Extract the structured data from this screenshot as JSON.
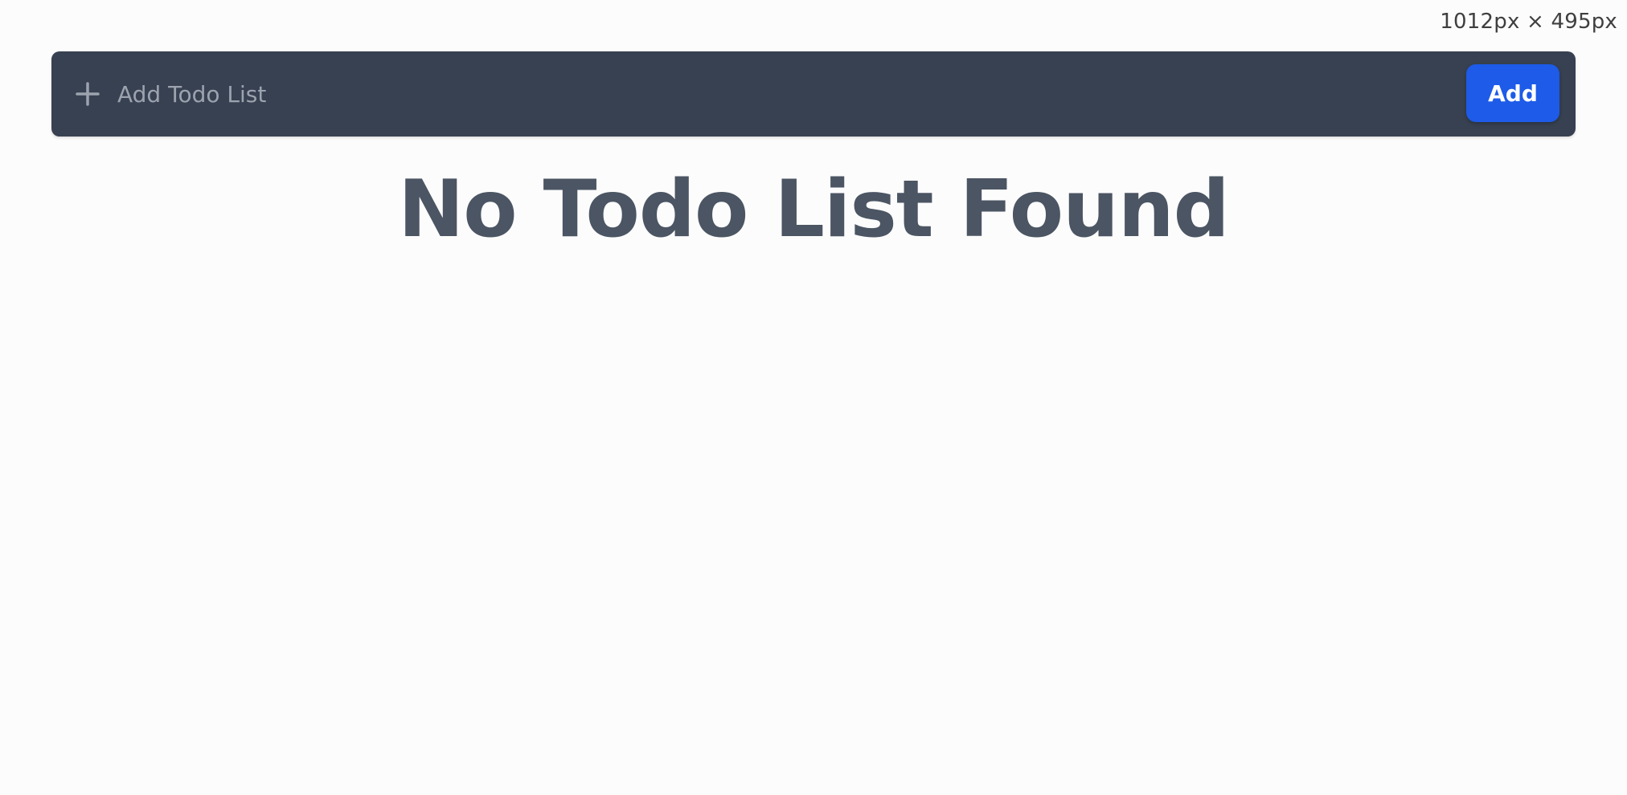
{
  "viewport_readout": "1012px × 495px",
  "add_bar": {
    "input_placeholder": "Add Todo List",
    "input_value": "",
    "add_button_label": "Add",
    "plus_icon": "plus-icon"
  },
  "main": {
    "empty_message": "No Todo List Found"
  },
  "colors": {
    "bar_background": "#374151",
    "button_background": "#1d5be8",
    "heading_text": "#4b5563",
    "page_background": "#fcfcfc"
  }
}
